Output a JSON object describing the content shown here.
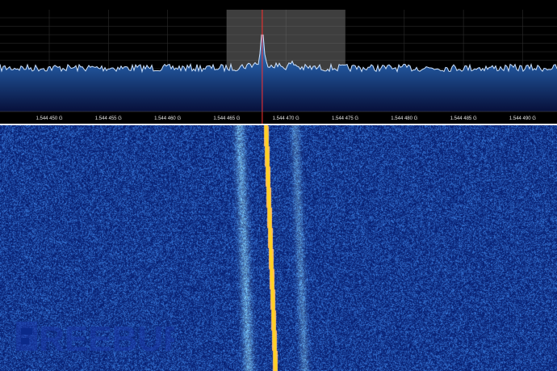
{
  "spectrum": {
    "freq_min_ghz": 1.54445,
    "freq_max_ghz": 1.54449,
    "center_freq_ghz": 1.544468,
    "filter_low_ghz": 1.544465,
    "filter_high_ghz": 1.544475,
    "tick_labels": [
      "1.544 450 G",
      "1.544 455 G",
      "1.544 460 G",
      "1.544 465 G",
      "1.544 470 G",
      "1.544 475 G",
      "1.544 480 G",
      "1.544 485 G",
      "1.544 490 G"
    ],
    "colors": {
      "background": "#000000",
      "fill_top": "#3d88c8",
      "fill_bottom": "#07103a",
      "trace": "#cfe4ff",
      "filter_band": "#8a8a8a",
      "center_marker": "#ff3030",
      "grid": "#3a3a3a"
    }
  },
  "waterfall": {
    "colors": {
      "background": "#0b2a8a",
      "noise_dark": "#06185e",
      "noise_light": "#2f66c8",
      "carrier_core": "#ffd21a",
      "carrier_edge": "#ffffff",
      "sideband": "#8fc4ff"
    }
  },
  "watermark": {
    "text": "REEBUF",
    "icon": "freebuf-logo-icon"
  }
}
